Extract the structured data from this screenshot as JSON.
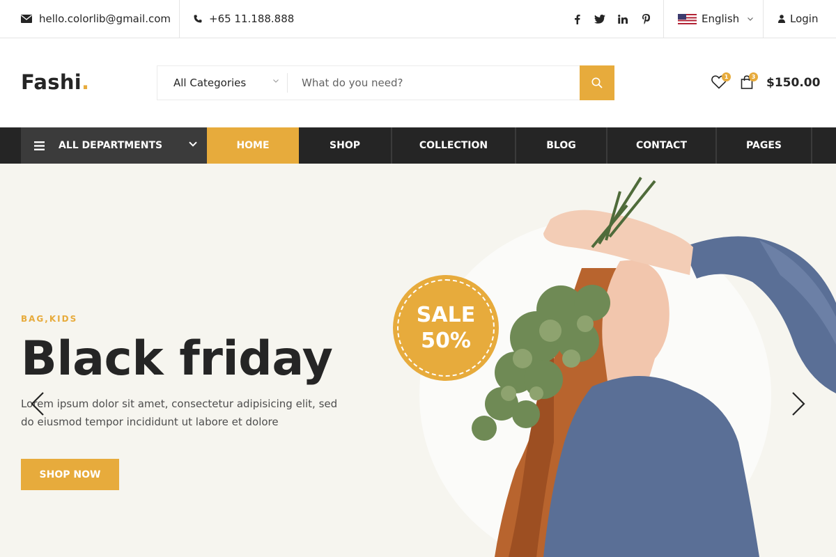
{
  "topbar": {
    "email": "hello.colorlib@gmail.com",
    "phone": "+65 11.188.888",
    "social": [
      "facebook-icon",
      "twitter-icon",
      "linkedin-icon",
      "pinterest-icon"
    ],
    "language": "English",
    "login_label": "Login"
  },
  "header": {
    "logo_text": "Fashi",
    "logo_dot": ".",
    "category_selected": "All Categories",
    "search_placeholder": "What do you need?",
    "wishlist_count": "1",
    "cart_count": "3",
    "cart_total": "$150.00"
  },
  "nav": {
    "departments_label": "ALL DEPARTMENTS",
    "links": [
      "HOME",
      "SHOP",
      "COLLECTION",
      "BLOG",
      "CONTACT",
      "PAGES"
    ],
    "active_index": 0
  },
  "hero": {
    "tag": "BAG,KIDS",
    "title": "Black friday",
    "text": "Lorem ipsum dolor sit amet, consectetur adipisicing elit, sed do eiusmod tempor incididunt ut labore et dolore",
    "button_label": "SHOP NOW",
    "sale_line1": "SALE",
    "sale_line2": "50%"
  },
  "colors": {
    "accent": "#e7ab3c",
    "nav_bg": "#252525",
    "hero_bg": "#f6f5ef"
  }
}
